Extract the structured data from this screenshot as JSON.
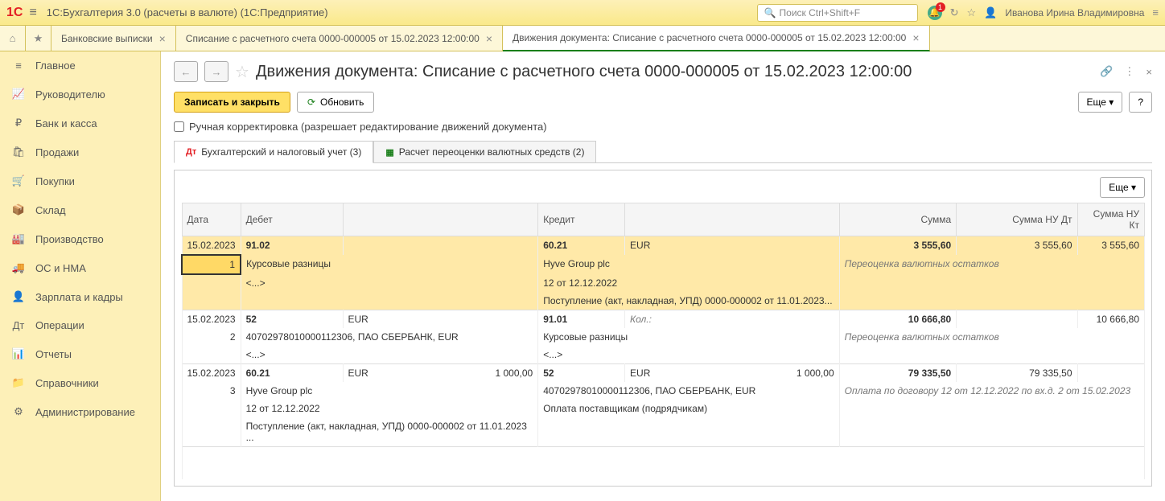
{
  "header": {
    "app_title": "1С:Бухгалтерия 3.0 (расчеты в валюте)  (1С:Предприятие)",
    "search_placeholder": "Поиск Ctrl+Shift+F",
    "bell_count": "1",
    "username": "Иванова Ирина Владимировна"
  },
  "tabs": {
    "t1": "Банковские выписки",
    "t2": "Списание с расчетного счета 0000-000005 от 15.02.2023 12:00:00",
    "t3": "Движения документа: Списание с расчетного счета 0000-000005 от 15.02.2023 12:00:00"
  },
  "sidebar": {
    "i0": "Главное",
    "i1": "Руководителю",
    "i2": "Банк и касса",
    "i3": "Продажи",
    "i4": "Покупки",
    "i5": "Склад",
    "i6": "Производство",
    "i7": "ОС и НМА",
    "i8": "Зарплата и кадры",
    "i9": "Операции",
    "i10": "Отчеты",
    "i11": "Справочники",
    "i12": "Администрирование"
  },
  "page": {
    "title": "Движения документа: Списание с расчетного счета 0000-000005 от 15.02.2023 12:00:00",
    "btn_save": "Записать и закрыть",
    "btn_refresh": "Обновить",
    "btn_more": "Еще",
    "btn_help": "?",
    "chk_manual": "Ручная корректировка (разрешает редактирование движений документа)",
    "tab2_1": "Бухгалтерский и налоговый учет (3)",
    "tab2_2": "Расчет переоценки валютных средств (2)"
  },
  "cols": {
    "date": "Дата",
    "debit": "Дебет",
    "credit": "Кредит",
    "sum": "Сумма",
    "sum_dt": "Сумма НУ Дт",
    "sum_kt": "Сумма НУ Кт"
  },
  "rows": {
    "r1_date": "15.02.2023",
    "r1_n": "1",
    "r1_d_acc": "91.02",
    "r1_c_acc": "60.21",
    "r1_c_cur": "EUR",
    "r1_sum": "3 555,60",
    "r1_dt": "3 555,60",
    "r1_kt": "3 555,60",
    "r1_d_sub1": "Курсовые разницы",
    "r1_c_sub1": "Hyve Group plc",
    "r1_note": "Переоценка валютных остатков",
    "r1_d_sub2": "<...>",
    "r1_c_sub2": "12 от 12.12.2022",
    "r1_c_sub3": "Поступление (акт, накладная, УПД) 0000-000002 от 11.01.2023...",
    "r2_date": "15.02.2023",
    "r2_n": "2",
    "r2_d_acc": "52",
    "r2_d_cur": "EUR",
    "r2_c_acc": "91.01",
    "r2_c_qty": "Кол.:",
    "r2_sum": "10 666,80",
    "r2_kt": "10 666,80",
    "r2_d_sub1": "40702978010000112306, ПАО СБЕРБАНК, EUR",
    "r2_c_sub1": "Курсовые разницы",
    "r2_note": "Переоценка валютных остатков",
    "r2_d_sub2": "<...>",
    "r2_c_sub2": "<...>",
    "r3_date": "15.02.2023",
    "r3_n": "3",
    "r3_d_acc": "60.21",
    "r3_d_cur": "EUR",
    "r3_d_qty": "1 000,00",
    "r3_c_acc": "52",
    "r3_c_cur": "EUR",
    "r3_c_qty": "1 000,00",
    "r3_sum": "79 335,50",
    "r3_dt": "79 335,50",
    "r3_d_sub1": "Hyve Group plc",
    "r3_c_sub1": "40702978010000112306, ПАО СБЕРБАНК, EUR",
    "r3_note": "Оплата по договору 12 от 12.12.2022 по вх.д. 2 от 15.02.2023",
    "r3_d_sub2": "12 от 12.12.2022",
    "r3_c_sub2": "Оплата поставщикам (подрядчикам)",
    "r3_d_sub3": "Поступление (акт, накладная, УПД) 0000-000002 от 11.01.2023 ..."
  }
}
